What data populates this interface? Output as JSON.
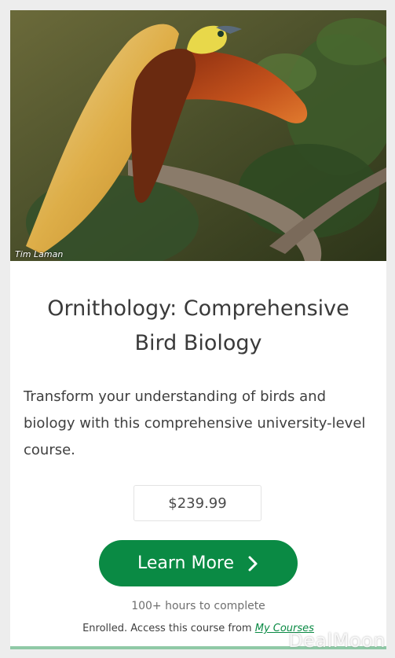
{
  "card": {
    "photo_credit": "Tim Laman",
    "title": "Ornithology: Comprehensive Bird Biology",
    "description": "Transform your understanding of birds and biology with this comprehensive university-level course.",
    "price": "$239.99",
    "cta_label": "Learn More",
    "cta_icon": "chevron-right-icon",
    "duration": "100+ hours to complete",
    "enrolled_prefix": "Enrolled. Access this course from ",
    "enrolled_link": "My Courses"
  },
  "watermark": "DealMoon",
  "colors": {
    "accent_green": "#0a8a44",
    "bottom_bar": "#8fc9a6",
    "page_bg": "#ededed"
  }
}
